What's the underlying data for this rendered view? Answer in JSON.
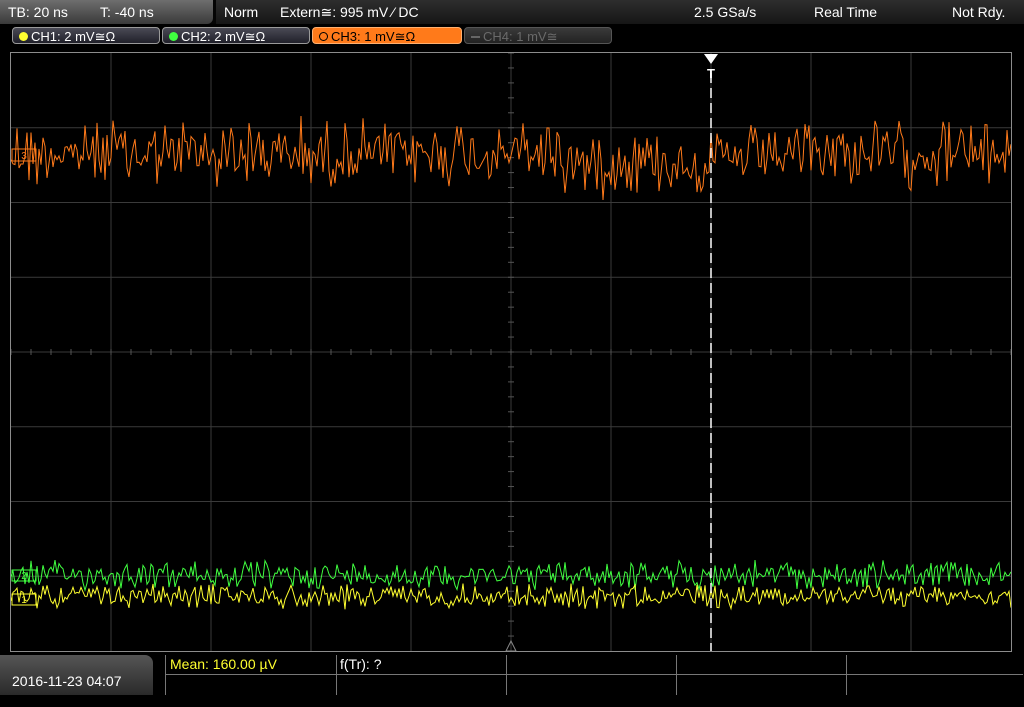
{
  "topbar": {
    "timebase": "TB: 20 ns",
    "trigger_time": "T: -40 ns",
    "mode": "Norm",
    "trigger_source": "Extern≅: 995 mV ⁄ DC",
    "sample_rate": "2.5 GSa/s",
    "acq_mode": "Real Time",
    "status": "Not Rdy."
  },
  "channels": [
    {
      "label": "CH1: 2 mV≅Ω",
      "color": "#ffff30",
      "state": "on"
    },
    {
      "label": "CH2: 2 mV≅Ω",
      "color": "#40ff40",
      "state": "on"
    },
    {
      "label": "CH3: 1 mV≅Ω",
      "color": "#ff7a1a",
      "state": "active"
    },
    {
      "label": "CH4: 1 mV≅",
      "color": "#555555",
      "state": "off"
    }
  ],
  "markers": {
    "ch3": "3",
    "ch2": "2",
    "ch1": "1",
    "trigger": "T"
  },
  "measurements": {
    "mean": "Mean: 160.00 µV",
    "ftr": "f(Tr): ?"
  },
  "footer": {
    "datetime": "2016-11-23 04:07"
  },
  "colors": {
    "ch1": "#ffff30",
    "ch2": "#40ff40",
    "ch3": "#ff7a1a",
    "grid": "#3a3a3a",
    "mean_text": "#ffff30"
  }
}
